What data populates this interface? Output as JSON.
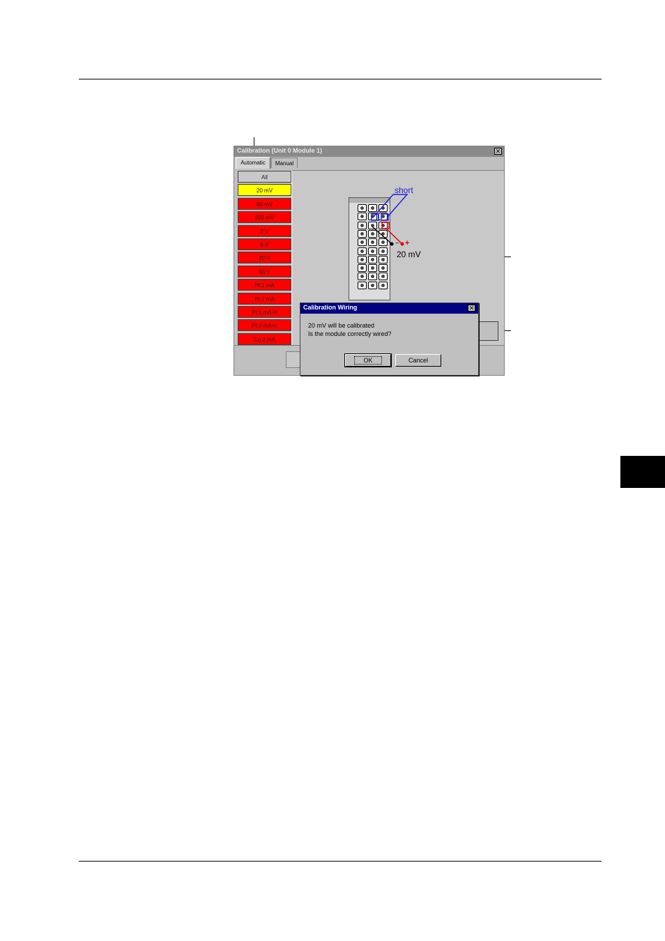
{
  "window": {
    "title": "Calibration (Unit 0 Module 1)",
    "close_glyph": "✕",
    "tabs": [
      {
        "label": "Automatic",
        "active": true
      },
      {
        "label": "Manual",
        "active": false
      }
    ],
    "ranges": [
      {
        "label": "All",
        "color": "#c0c0c0"
      },
      {
        "label": "20 mV",
        "color": "#ffff00"
      },
      {
        "label": "60 mV",
        "color": "#ff0000"
      },
      {
        "label": "200 mV",
        "color": "#ff0000"
      },
      {
        "label": "2 V",
        "color": "#ff0000"
      },
      {
        "label": "6 V",
        "color": "#ff0000"
      },
      {
        "label": "20 V",
        "color": "#ff0000"
      },
      {
        "label": "50 V",
        "color": "#ff0000"
      },
      {
        "label": "Pt:1 mA",
        "color": "#ff0000"
      },
      {
        "label": "Pt:2 mA",
        "color": "#ff0000"
      },
      {
        "label": "Pt:1 mA-H",
        "color": "#ff0000"
      },
      {
        "label": "Pt:2 mA-H",
        "color": "#ff0000"
      },
      {
        "label": "Cu:2 mA",
        "color": "#ff0000"
      }
    ]
  },
  "wiring": {
    "short_label": "short",
    "source_label": "20 mV",
    "minus": "−",
    "plus": "+",
    "short_color": "#2020e0",
    "plus_color": "#e00000"
  },
  "dialog": {
    "title": "Calibration Wiring",
    "close_glyph": "✕",
    "message_line1": "20 mV will be calibrated",
    "message_line2": "Is the module correctly wired?",
    "ok_label": "OK",
    "cancel_label": "Cancel"
  }
}
